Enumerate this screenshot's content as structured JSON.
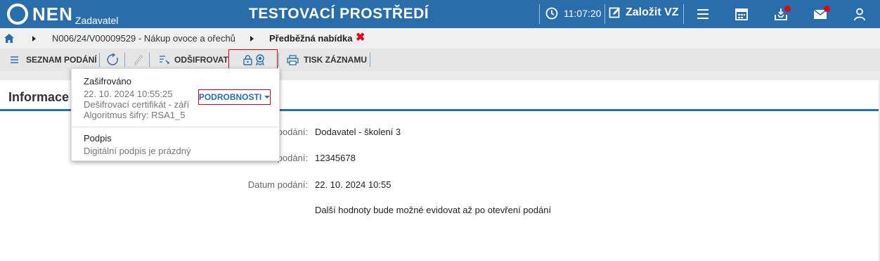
{
  "header": {
    "logo_text": "NEN",
    "logo_sub": "Zadavatel",
    "env_title": "TESTOVACÍ PROSTŘEDÍ",
    "time": "11:07:20",
    "create_label": "Založit VZ"
  },
  "breadcrumb": {
    "item": "N006/24/V00009529 - Nákup ovoce a ořechů",
    "current": "Předběžná nabídka",
    "close": "✖"
  },
  "toolbar": {
    "list_label": "SEZNAM PODÁNÍ",
    "decrypt_label": "ODŠIFROVAT",
    "print_label": "TISK ZÁZNAMU"
  },
  "panel": {
    "title": "Informace I",
    "fields": [
      {
        "label": "podání:",
        "value": "Dodavatel - školení 3"
      },
      {
        "label": "podání:",
        "value": "12345678"
      },
      {
        "label": "Datum podání:",
        "value": "22. 10. 2024 10:55"
      }
    ],
    "note": "Další hodnoty bude možné evidovat až po otevření podání"
  },
  "popup": {
    "encrypted_title": "Zašifrováno",
    "encrypted_date": "22. 10. 2024 10:55:25",
    "encrypted_cert": "Dešifrovací certifikát - září",
    "encrypted_algo": "Algoritmus šifry: RSA1_5",
    "details_label": "PODROBNOSTI",
    "signature_title": "Podpis",
    "signature_status": "Digitální podpis je prázdný"
  },
  "colors": {
    "brand_blue": "#2a6dab",
    "highlight_red": "#d0021b",
    "notification_red": "#e3001b"
  }
}
